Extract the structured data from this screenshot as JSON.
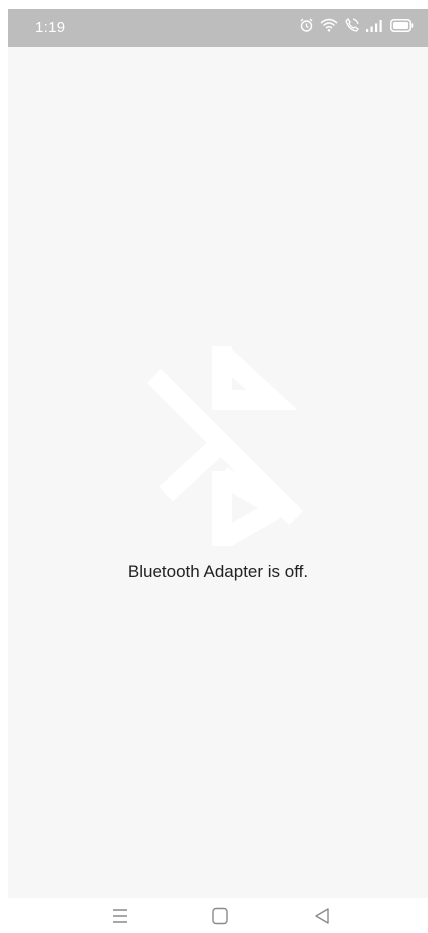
{
  "status_bar": {
    "time": "1:19",
    "icons": [
      "alarm-icon",
      "wifi-icon",
      "call-icon",
      "signal-icon",
      "battery-icon"
    ]
  },
  "main": {
    "message": "Bluetooth Adapter is off.",
    "illustration_icon": "bluetooth-disabled-icon"
  },
  "nav_bar": {
    "buttons": [
      "menu-icon",
      "home-icon",
      "back-icon"
    ]
  },
  "colors": {
    "background": "#f7f7f7",
    "status_bar": "#bdbdbd",
    "text": "#222222",
    "nav_icon": "#8a8a8a",
    "illustration": "#ffffff"
  }
}
